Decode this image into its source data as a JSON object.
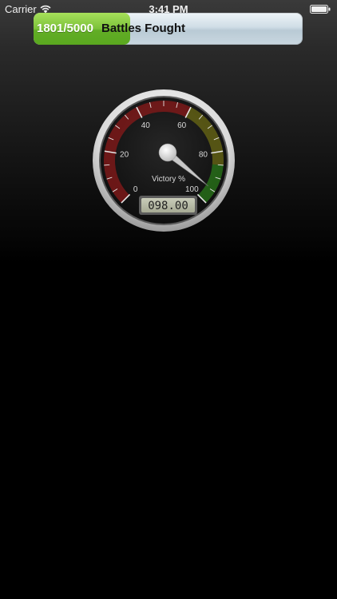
{
  "status_bar": {
    "carrier": "Carrier",
    "time": "3:41 PM",
    "icons": [
      "wifi-icon",
      "battery-icon"
    ]
  },
  "progress": {
    "count_label": "1801/5000",
    "caption": "Battles Fought",
    "current": 1801,
    "total": 5000,
    "fill_color": "#7cc23a"
  },
  "gauge": {
    "title": "Victory %",
    "min": 0,
    "max": 100,
    "value": 98,
    "readout": "098.00",
    "tick_labels": [
      "0",
      "20",
      "40",
      "60",
      "80",
      "100"
    ],
    "zone_colors": [
      "#8a1a1a",
      "#6b6a14",
      "#2a7a1a"
    ]
  }
}
